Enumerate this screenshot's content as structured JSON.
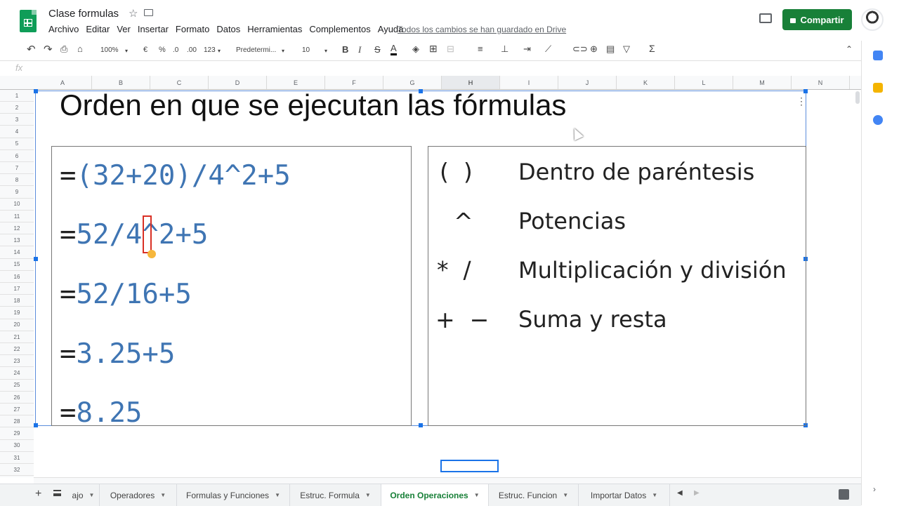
{
  "header": {
    "doc_title": "Clase formulas",
    "menu": [
      "Archivo",
      "Editar",
      "Ver",
      "Insertar",
      "Formato",
      "Datos",
      "Herramientas",
      "Complementos",
      "Ayuda"
    ],
    "save_status": "Todos los cambios se han guardado en Drive",
    "share_label": "Compartir"
  },
  "toolbar": {
    "zoom": "100%",
    "currency": "€",
    "percent": "%",
    "decimal_less": ".0",
    "decimal_more": ".00",
    "number_format": "123",
    "font": "Predetermi...",
    "font_size": "10",
    "bold": "B",
    "italic": "I",
    "strike": "S",
    "text_color": "A",
    "functions": "Σ"
  },
  "formula_bar": {
    "fx_label": "fx",
    "value": ""
  },
  "columns": [
    "A",
    "B",
    "C",
    "D",
    "E",
    "F",
    "G",
    "H",
    "I",
    "J",
    "K",
    "L",
    "M",
    "N"
  ],
  "selected_column": "H",
  "rows": [
    "1",
    "2",
    "3",
    "4",
    "5",
    "6",
    "7",
    "8",
    "9",
    "10",
    "11",
    "12",
    "13",
    "14",
    "15",
    "16",
    "17",
    "18",
    "19",
    "20",
    "21",
    "22",
    "23",
    "24",
    "25",
    "26",
    "27",
    "28",
    "29",
    "30",
    "31",
    "32"
  ],
  "drawing": {
    "title": "Orden en que se ejecutan las fórmulas",
    "steps": [
      {
        "eq": "=",
        "expr": "(32+20)/4^2+5"
      },
      {
        "eq": "=",
        "expr": "52/4^2+5"
      },
      {
        "eq": "=",
        "expr": "52/16+5"
      },
      {
        "eq": "=",
        "expr": "3.25+5"
      },
      {
        "eq": "=",
        "expr": "8.25"
      }
    ],
    "rules": [
      {
        "symbols": "(  )",
        "desc": "Dentro de paréntesis"
      },
      {
        "symbols": "^",
        "desc": "Potencias"
      },
      {
        "symbols": "*  /",
        "desc": "Multiplicación y división"
      },
      {
        "symbols": "+  −",
        "desc": "Suma y resta"
      }
    ]
  },
  "sheet_tabs": [
    {
      "label": "ajo",
      "active": false
    },
    {
      "label": "Operadores",
      "active": false
    },
    {
      "label": "Formulas y Funciones",
      "active": false
    },
    {
      "label": "Estruc. Formula",
      "active": false
    },
    {
      "label": "Orden Operaciones",
      "active": true
    },
    {
      "label": "Estruc. Funcion",
      "active": false
    },
    {
      "label": "Importar Datos",
      "active": false
    }
  ],
  "colors": {
    "accent": "#1a73e8",
    "share": "#188038",
    "formula_blue": "#3f75b3",
    "cursor_red": "#d93025"
  }
}
